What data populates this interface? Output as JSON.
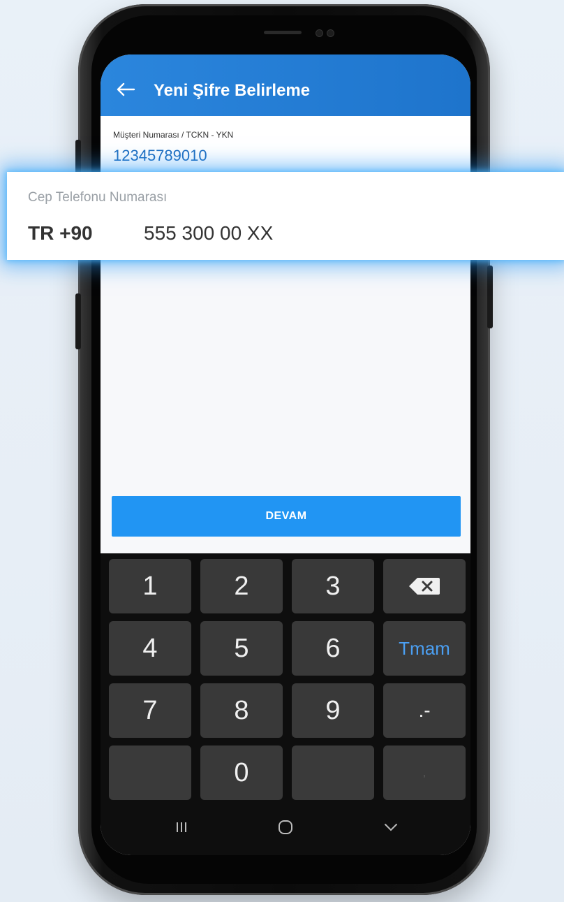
{
  "header": {
    "title": "Yeni Şifre Belirleme"
  },
  "customer_field": {
    "label": "Müşteri Numarası / TCKN - YKN",
    "value": "12345789010"
  },
  "phone_field": {
    "label": "Cep Telefonu Numarası",
    "country_code": "TR +90",
    "number": "555 300 00 XX"
  },
  "continue_button": {
    "label": "DEVAM"
  },
  "keypad": {
    "keys": [
      "1",
      "2",
      "3",
      "4",
      "5",
      "6",
      "7",
      "8",
      "9",
      "0"
    ],
    "done_label": "Tmam",
    "dot_dash_label": ".-",
    "comma_label": ","
  },
  "colors": {
    "accent": "#2195f3",
    "appbar": "#1e74cc",
    "glow": "#2896f5"
  },
  "icons": [
    "back-arrow-icon",
    "backspace-icon",
    "recent-apps-icon",
    "home-icon",
    "back-nav-icon"
  ]
}
